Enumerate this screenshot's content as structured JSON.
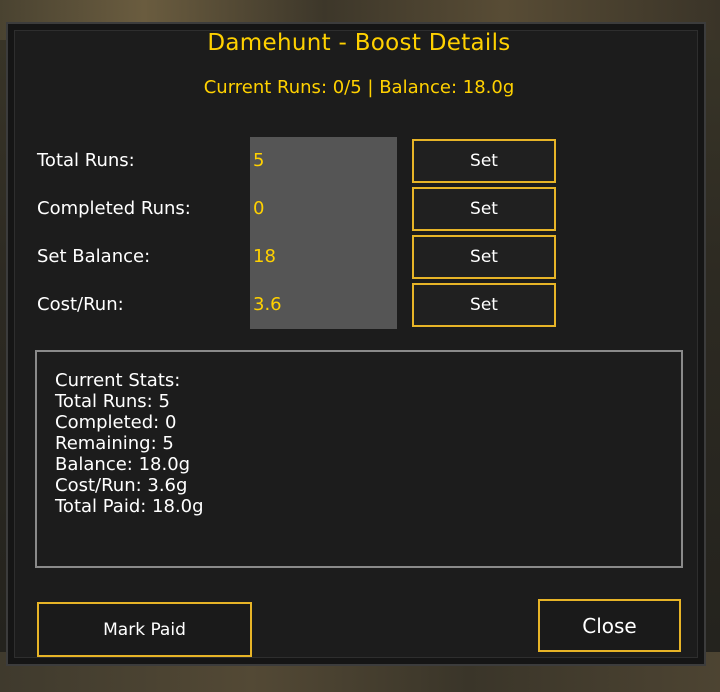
{
  "window": {
    "title": "Damehunt - Boost Details",
    "subtitle": "Current Runs: 0/5 | Balance: 18.0g"
  },
  "fields": [
    {
      "label": "Total Runs:",
      "value": "5",
      "button": "Set"
    },
    {
      "label": "Completed Runs:",
      "value": "0",
      "button": "Set"
    },
    {
      "label": "Set Balance:",
      "value": "18",
      "button": "Set"
    },
    {
      "label": "Cost/Run:",
      "value": "3.6",
      "button": "Set"
    }
  ],
  "stats": [
    "Current Stats:",
    "Total Runs: 5",
    "Completed: 0",
    "Remaining: 5",
    "Balance: 18.0g",
    "Cost/Run: 3.6g",
    "Total Paid: 18.0g"
  ],
  "buttons": {
    "mark_paid": "Mark Paid",
    "close": "Close"
  },
  "colors": {
    "accent_gold": "#ffd100",
    "button_border": "#e7b427",
    "panel_bg": "#1c1c1c",
    "input_bg": "#555555"
  }
}
